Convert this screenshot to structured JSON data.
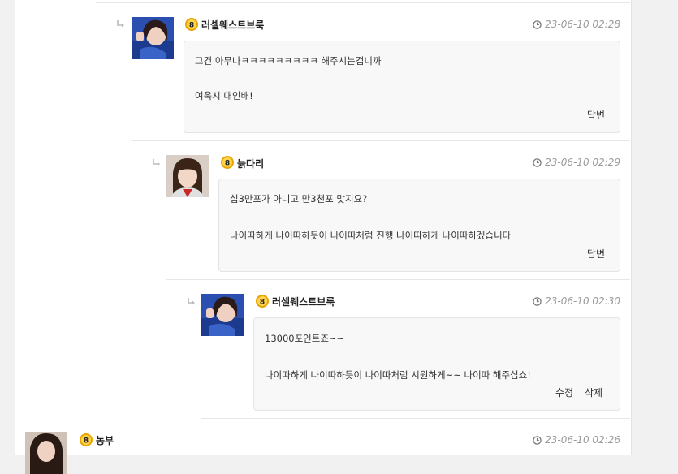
{
  "comments": [
    {
      "nickname": "러셀웨스트브룩",
      "level": "8",
      "time": "23-06-10 02:28",
      "lines": [
        "그건 아무나ㅋㅋㅋㅋㅋㅋㅋㅋㅋ 해주시는겁니까",
        "여욱시 대인배!"
      ],
      "actions": [
        "답변"
      ]
    },
    {
      "nickname": "늙다리",
      "level": "8",
      "time": "23-06-10 02:29",
      "lines": [
        "십3만포가 아니고 만3천포 맞지요?",
        "나이따하게 나이따하듯이 나이따처럼 진행 나이따하게 나이따하겠습니다"
      ],
      "actions": [
        "답변"
      ]
    },
    {
      "nickname": "러셀웨스트브룩",
      "level": "8",
      "time": "23-06-10 02:30",
      "lines": [
        "13000포인트죠~~",
        "나이따하게 나이따하듯이 나이따처럼 시원하게~~ 나이따 해주십쇼!"
      ],
      "actions": [
        "수정",
        "삭제"
      ]
    },
    {
      "nickname": "농부",
      "level": "8",
      "time": "23-06-10 02:26"
    }
  ],
  "colors": {
    "level_badge": "#e8a400",
    "time_text": "#9a9a9a",
    "bubble_bg": "#f8f8f8"
  },
  "icons": {
    "reply": "reply-arrow-icon",
    "clock": "clock-icon",
    "level": "level-badge-icon"
  }
}
